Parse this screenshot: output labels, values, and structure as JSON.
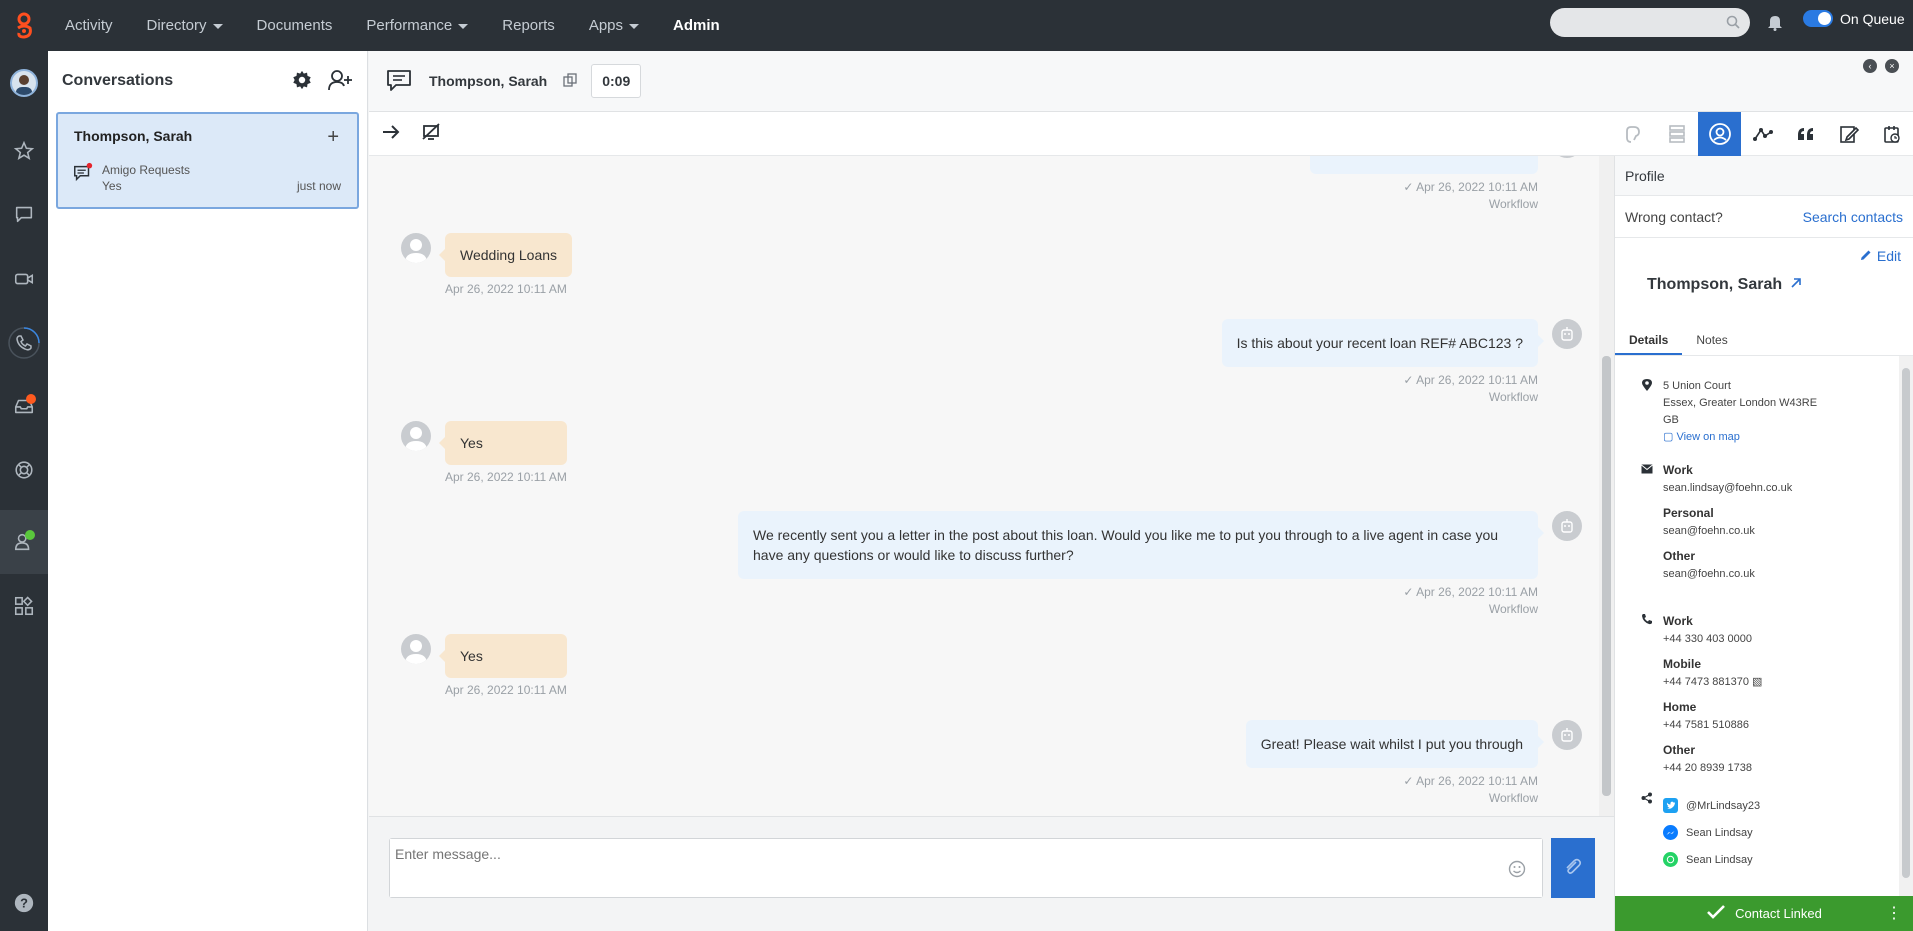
{
  "topnav": {
    "items": [
      {
        "label": "Activity",
        "dropdown": false
      },
      {
        "label": "Directory",
        "dropdown": true
      },
      {
        "label": "Documents",
        "dropdown": false
      },
      {
        "label": "Performance",
        "dropdown": true
      },
      {
        "label": "Reports",
        "dropdown": false
      },
      {
        "label": "Apps",
        "dropdown": true
      },
      {
        "label": "Admin",
        "dropdown": false,
        "active": true
      }
    ],
    "search_placeholder": "",
    "queue_label": "On Queue",
    "accent": "#2a7ae2",
    "brand": "#ff4f1f"
  },
  "rail": {
    "icons": [
      "avatar",
      "star-icon",
      "chat-icon",
      "video-icon",
      "phone-icon",
      "inbox-icon",
      "lifebuoy-icon",
      "agent-status-icon",
      "apps-grid-icon",
      "help-icon"
    ]
  },
  "conversations": {
    "title": "Conversations",
    "items": [
      {
        "name": "Thompson, Sarah",
        "queue": "Amigo Requests",
        "last_message": "Yes",
        "time": "just now"
      }
    ]
  },
  "header": {
    "contact_name": "Thompson, Sarah",
    "timer": "0:09"
  },
  "messages": [
    {
      "dir": "out",
      "text": "",
      "time": "Apr 26, 2022 10:11 AM",
      "sender": "Workflow"
    },
    {
      "dir": "in",
      "text": "Wedding Loans",
      "time": "Apr 26, 2022 10:11 AM"
    },
    {
      "dir": "out",
      "text": "Is this about your recent loan REF# ABC123 ?",
      "time": "Apr 26, 2022 10:11 AM",
      "sender": "Workflow"
    },
    {
      "dir": "in",
      "text": "Yes",
      "time": "Apr 26, 2022 10:11 AM"
    },
    {
      "dir": "out",
      "text": "We recently sent you a letter in the post about this loan. Would you like me to put you through to a live agent in case you have any questions or would like to discuss further?",
      "time": "Apr 26, 2022 10:11 AM",
      "sender": "Workflow"
    },
    {
      "dir": "in",
      "text": "Yes",
      "time": "Apr 26, 2022 10:11 AM"
    },
    {
      "dir": "out",
      "text": "Great! Please wait whilst I put you through",
      "time": "Apr 26, 2022 10:11 AM",
      "sender": "Workflow"
    }
  ],
  "composer": {
    "placeholder": "Enter message..."
  },
  "profile": {
    "title": "Profile",
    "wrong_contact": "Wrong contact?",
    "search_contacts": "Search contacts",
    "edit": "Edit",
    "name": "Thompson, Sarah",
    "tabs": [
      "Details",
      "Notes"
    ],
    "address": {
      "line1": "5 Union Court",
      "line2": "Essex, Greater London W43RE",
      "line3": "GB",
      "map_link": "View on map"
    },
    "emails": [
      {
        "label": "Work",
        "value": "sean.lindsay@foehn.co.uk"
      },
      {
        "label": "Personal",
        "value": "sean@foehn.co.uk"
      },
      {
        "label": "Other",
        "value": "sean@foehn.co.uk"
      }
    ],
    "phones": [
      {
        "label": "Work",
        "value": "+44 330 403 0000"
      },
      {
        "label": "Mobile",
        "value": "+44 7473 881370"
      },
      {
        "label": "Home",
        "value": "+44 7581 510886"
      },
      {
        "label": "Other",
        "value": "+44 20 8939 1738"
      }
    ],
    "social": [
      {
        "network": "twitter",
        "value": "@MrLindsay23"
      },
      {
        "network": "messenger",
        "value": "Sean Lindsay"
      },
      {
        "network": "whatsapp",
        "value": "Sean Lindsay"
      }
    ],
    "linked_label": "Contact Linked",
    "linked_color": "#3b9a2e"
  }
}
